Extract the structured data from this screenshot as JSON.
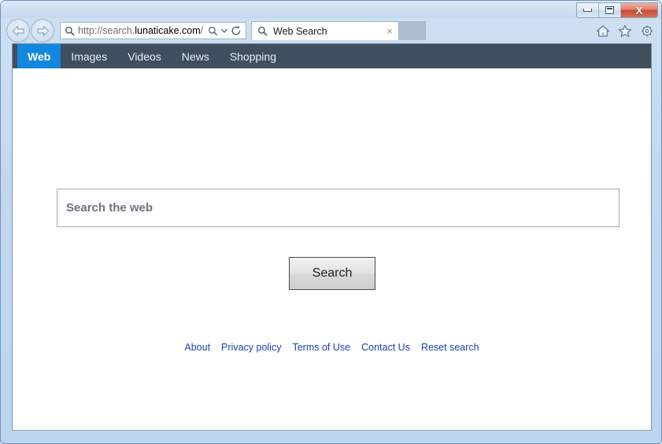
{
  "window": {
    "controls": {
      "minimize_label": "Minimize",
      "maximize_label": "Maximize",
      "close_label": "X"
    }
  },
  "browser": {
    "back_label": "Back",
    "forward_label": "Forward",
    "address": {
      "url_scheme": "http://search.",
      "url_domain": "lunaticake.com",
      "url_path": "/",
      "search_action_label": "Search",
      "dropdown_label": "Address dropdown",
      "refresh_label": "Refresh"
    },
    "tab": {
      "title": "Web Search",
      "close_label": "×"
    },
    "new_tab_label": "New tab",
    "tools": {
      "home_label": "Home",
      "favorites_label": "Favorites",
      "settings_label": "Tools"
    }
  },
  "site": {
    "nav": [
      {
        "label": "Web",
        "active": true
      },
      {
        "label": "Images",
        "active": false
      },
      {
        "label": "Videos",
        "active": false
      },
      {
        "label": "News",
        "active": false
      },
      {
        "label": "Shopping",
        "active": false
      }
    ],
    "search": {
      "placeholder": "Search the web",
      "value": "",
      "button_label": "Search"
    },
    "footer_links": [
      {
        "label": "About"
      },
      {
        "label": "Privacy policy"
      },
      {
        "label": "Terms of Use"
      },
      {
        "label": "Contact Us"
      },
      {
        "label": "Reset search"
      }
    ]
  },
  "colors": {
    "nav_bg": "#3f4f5e",
    "nav_active": "#1188dd",
    "link": "#1a3fb5",
    "frame": "#c3d8ef"
  }
}
